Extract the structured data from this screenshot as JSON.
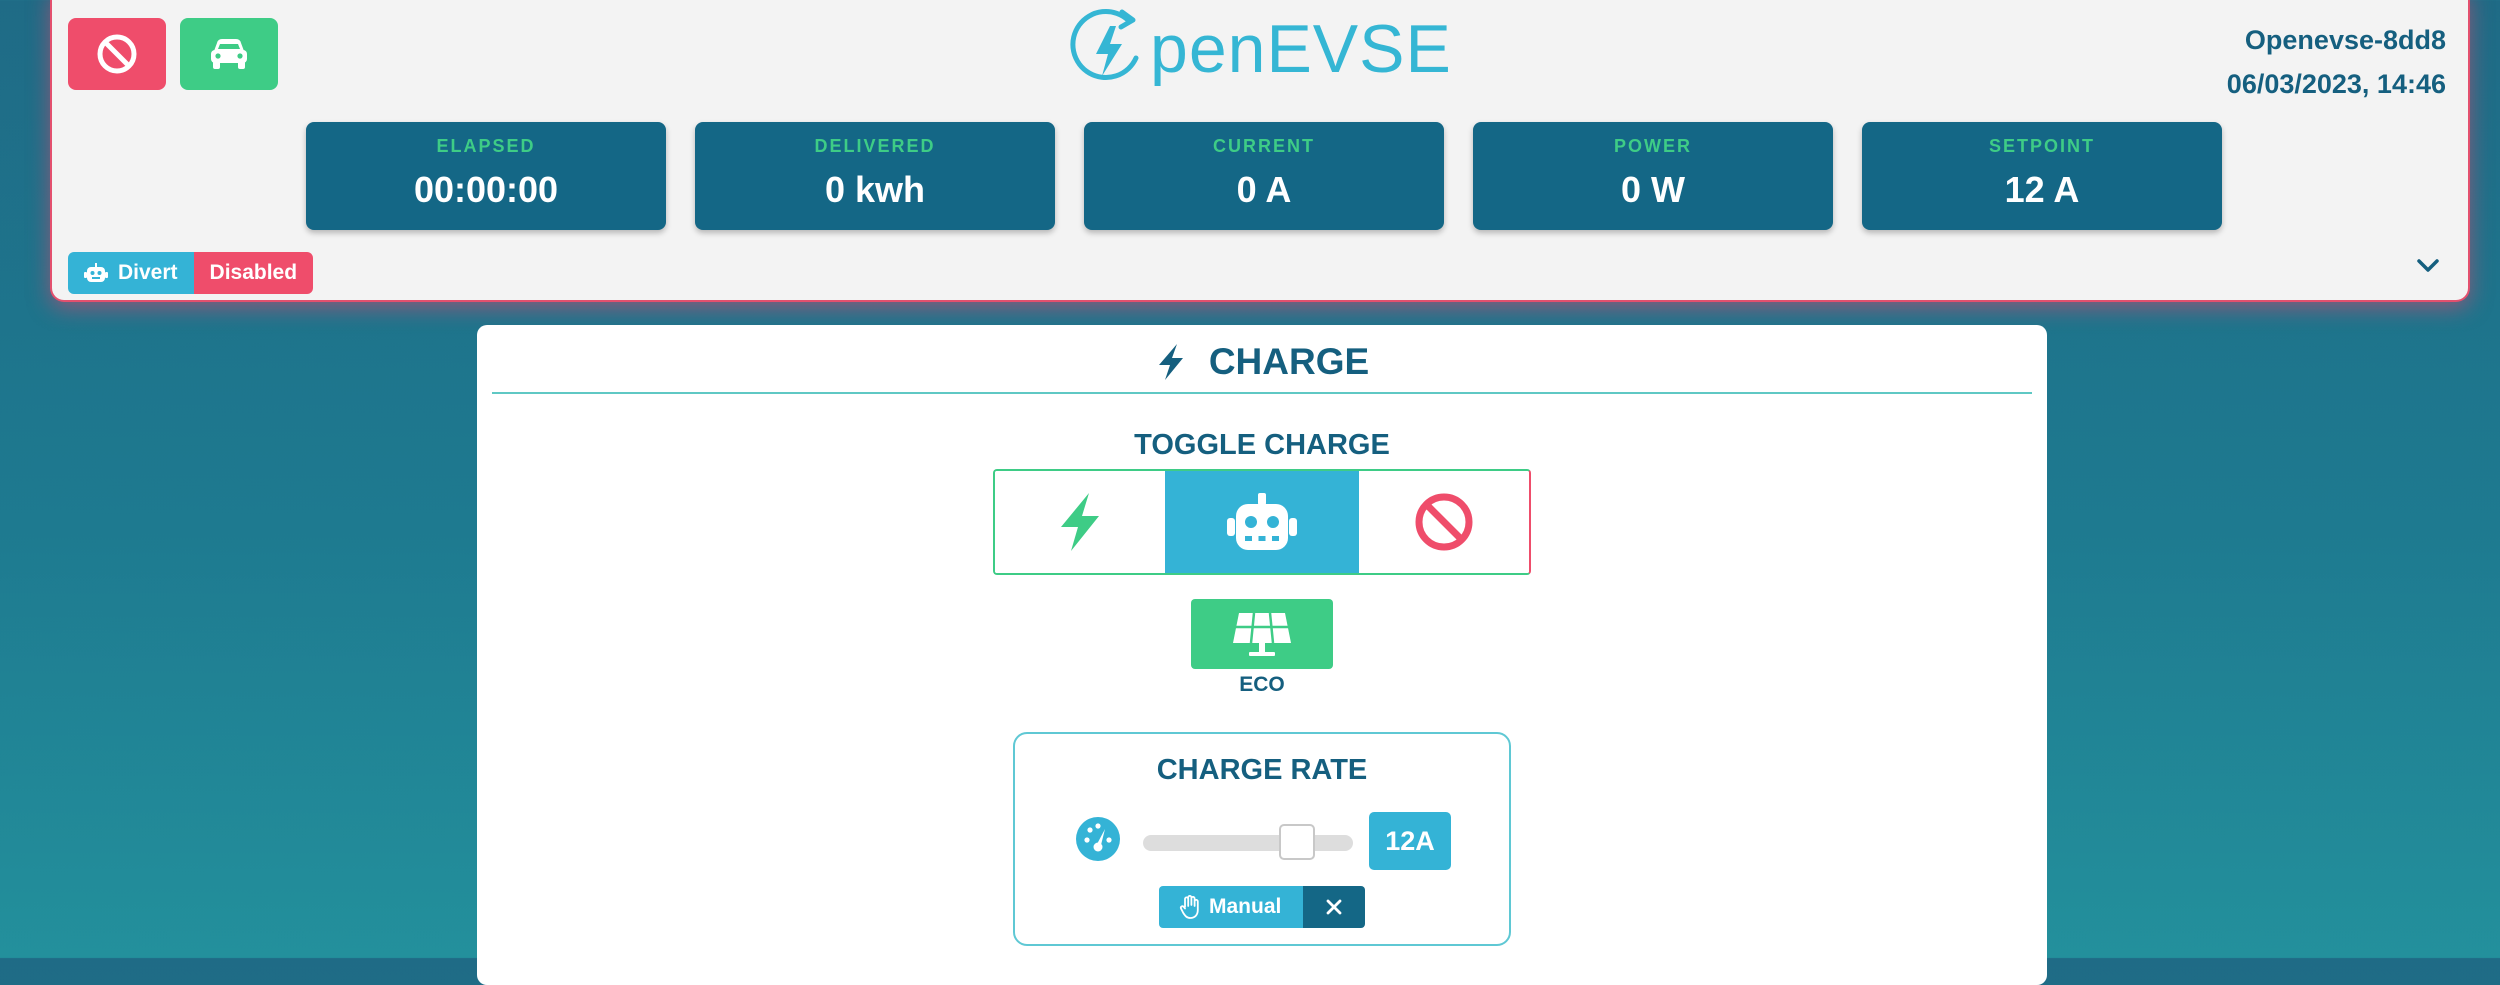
{
  "header": {
    "logo_text": "penEVSE",
    "device_name": "Openevse-8dd8",
    "datetime": "06/03/2023, 14:46",
    "stats": [
      {
        "label": "ELAPSED",
        "value": "00:00:00"
      },
      {
        "label": "DELIVERED",
        "value": "0 kwh"
      },
      {
        "label": "CURRENT",
        "value": "0 A"
      },
      {
        "label": "POWER",
        "value": "0 W"
      },
      {
        "label": "SETPOINT",
        "value": "12 A"
      }
    ],
    "divert": {
      "label": "Divert",
      "status": "Disabled"
    }
  },
  "charge": {
    "title": "CHARGE",
    "toggle_title": "TOGGLE CHARGE",
    "toggle_options": [
      "bolt-icon",
      "robot-icon",
      "ban-icon"
    ],
    "eco_label": "ECO",
    "rate": {
      "title": "CHARGE RATE",
      "value": "12A",
      "slider_level": 0.78,
      "mode": "Manual"
    }
  },
  "colors": {
    "primary": "#146786",
    "accent": "#34b3d6",
    "green": "#3ecc86",
    "red": "#ef4d6b",
    "text": "#155f7f"
  }
}
